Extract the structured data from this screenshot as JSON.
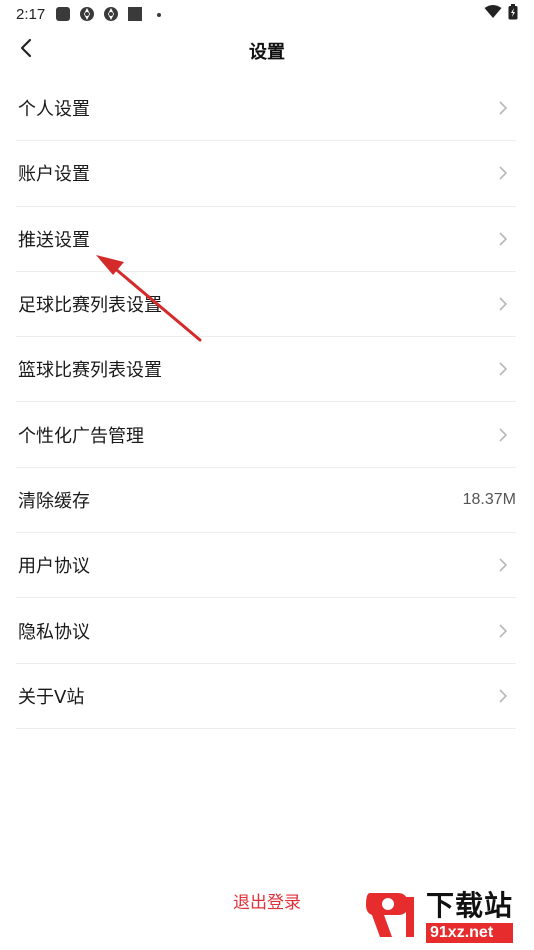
{
  "status_bar": {
    "time": "2:17",
    "icons": [
      "square-app-icon",
      "aperture-icon",
      "aperture-icon",
      "square-app-icon",
      "dot-icon"
    ],
    "right_icons": [
      "wifi-icon",
      "battery-charging-icon"
    ]
  },
  "header": {
    "title": "设置",
    "back_icon": "chevron-left-icon"
  },
  "settings": {
    "items": [
      {
        "label": "个人设置",
        "value": ""
      },
      {
        "label": "账户设置",
        "value": ""
      },
      {
        "label": "推送设置",
        "value": ""
      },
      {
        "label": "足球比赛列表设置",
        "value": ""
      },
      {
        "label": "篮球比赛列表设置",
        "value": ""
      },
      {
        "label": "个性化广告管理",
        "value": ""
      },
      {
        "label": "清除缓存",
        "value": "18.37M"
      },
      {
        "label": "用户协议",
        "value": ""
      },
      {
        "label": "隐私协议",
        "value": ""
      },
      {
        "label": "关于V站",
        "value": ""
      }
    ]
  },
  "logout": {
    "label": "退出登录"
  },
  "watermark": {
    "title": "下载站",
    "subtitle": "91xz.net"
  },
  "colors": {
    "accent_red": "#e0303a",
    "arrow_red": "#d42a2a",
    "divider": "#ececec",
    "chevron": "#b8b8b8"
  }
}
